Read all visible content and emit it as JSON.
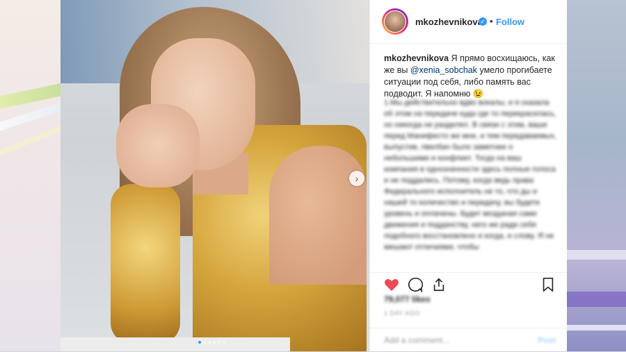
{
  "post": {
    "username": "mkozhevnikova",
    "verified_symbol": "✓",
    "separator": "•",
    "follow_label": "Follow"
  },
  "caption": {
    "author": "mkozhevnikova",
    "text_before": " Я прямо восхищаюсь, как же вы ",
    "mention": "@xenia_sobchak",
    "text_after": " умело прогибаете ситуации под себя, либо память вас подводит. Я напомню 😉",
    "blurred_text": "1.Мы действительно вдво вокалы, и я сказала об этом на передаче куда где то перекрасилась, но никогда не разделял. В связи с этим, ваши перед Манифесто же мне, и тем передаваемых, выпустив, пвелбач было заметнее о небольшими и конфликт. Тогда на ваш компания в однозначности здесь полные голоса и не поддались. Потому, когда ведь права Федерального исполнитель не то, что ды и нашей то количество и передачу, вы будете уровень и оплачены. Будет мозданая сами движения и подданству, него же ради себя подобного восстановлено и когда, и слову. Я не мешают отличиями, чтобы"
  },
  "stats": {
    "likes": "79,077 likes",
    "time": "1 DAY AGO"
  },
  "comment": {
    "placeholder": "Add a comment...",
    "post_label": "Post"
  },
  "colors": {
    "accent": "#3897f0",
    "like": "#ed4956",
    "text": "#262626"
  },
  "carousel": {
    "total_slides": 6,
    "active_slide": 1
  }
}
